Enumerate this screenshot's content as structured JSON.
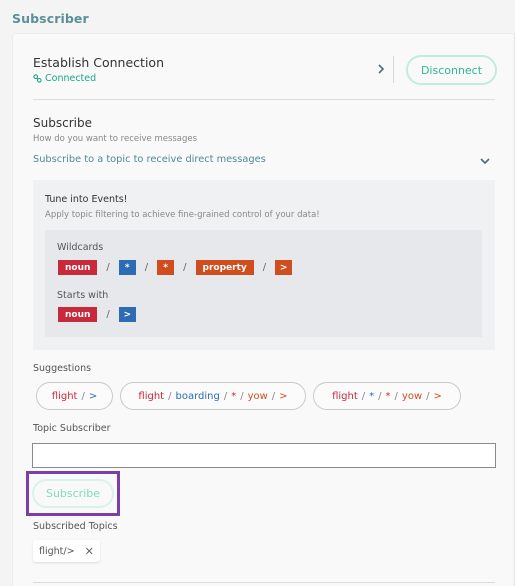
{
  "page": {
    "title": "Subscriber"
  },
  "connection": {
    "title": "Establish Connection",
    "status": "Connected",
    "disconnect_label": "Disconnect"
  },
  "subscribe": {
    "title": "Subscribe",
    "description": "How do you want to receive messages",
    "selected_option": "Subscribe to a topic to receive direct messages"
  },
  "events": {
    "title": "Tune into Events!",
    "description": "Apply topic filtering to achieve fine-grained control of your data!",
    "wildcards_label": "Wildcards",
    "wildcards_tokens": [
      {
        "text": "noun",
        "color": "red"
      },
      {
        "text": "*",
        "color": "blue"
      },
      {
        "text": "*",
        "color": "orange"
      },
      {
        "text": "property",
        "color": "orange"
      },
      {
        "text": ">",
        "color": "orange"
      }
    ],
    "starts_with_label": "Starts with",
    "starts_with_tokens": [
      {
        "text": "noun",
        "color": "red"
      },
      {
        "text": ">",
        "color": "blue"
      }
    ],
    "separator": "/"
  },
  "colors": {
    "red": "#c8293b",
    "blue": "#2b6cb5",
    "orange": "#d04e1d",
    "accent_teal": "#2fb894",
    "highlight_purple": "#7b3fa6"
  },
  "suggestions": {
    "label": "Suggestions",
    "items": [
      [
        {
          "text": "flight",
          "color": "red"
        },
        {
          "text": ">",
          "color": "blue"
        }
      ],
      [
        {
          "text": "flight",
          "color": "red"
        },
        {
          "text": "boarding",
          "color": "blue"
        },
        {
          "text": "*",
          "color": "red"
        },
        {
          "text": "yow",
          "color": "orange"
        },
        {
          "text": ">",
          "color": "orange"
        }
      ],
      [
        {
          "text": "flight",
          "color": "red"
        },
        {
          "text": "*",
          "color": "blue"
        },
        {
          "text": "*",
          "color": "red"
        },
        {
          "text": "yow",
          "color": "orange"
        },
        {
          "text": ">",
          "color": "orange"
        }
      ]
    ]
  },
  "topic_subscriber": {
    "label": "Topic Subscriber",
    "value": "",
    "placeholder": "",
    "subscribe_label": "Subscribe"
  },
  "subscribed_topics": {
    "label": "Subscribed Topics",
    "items": [
      "flight/>"
    ]
  }
}
